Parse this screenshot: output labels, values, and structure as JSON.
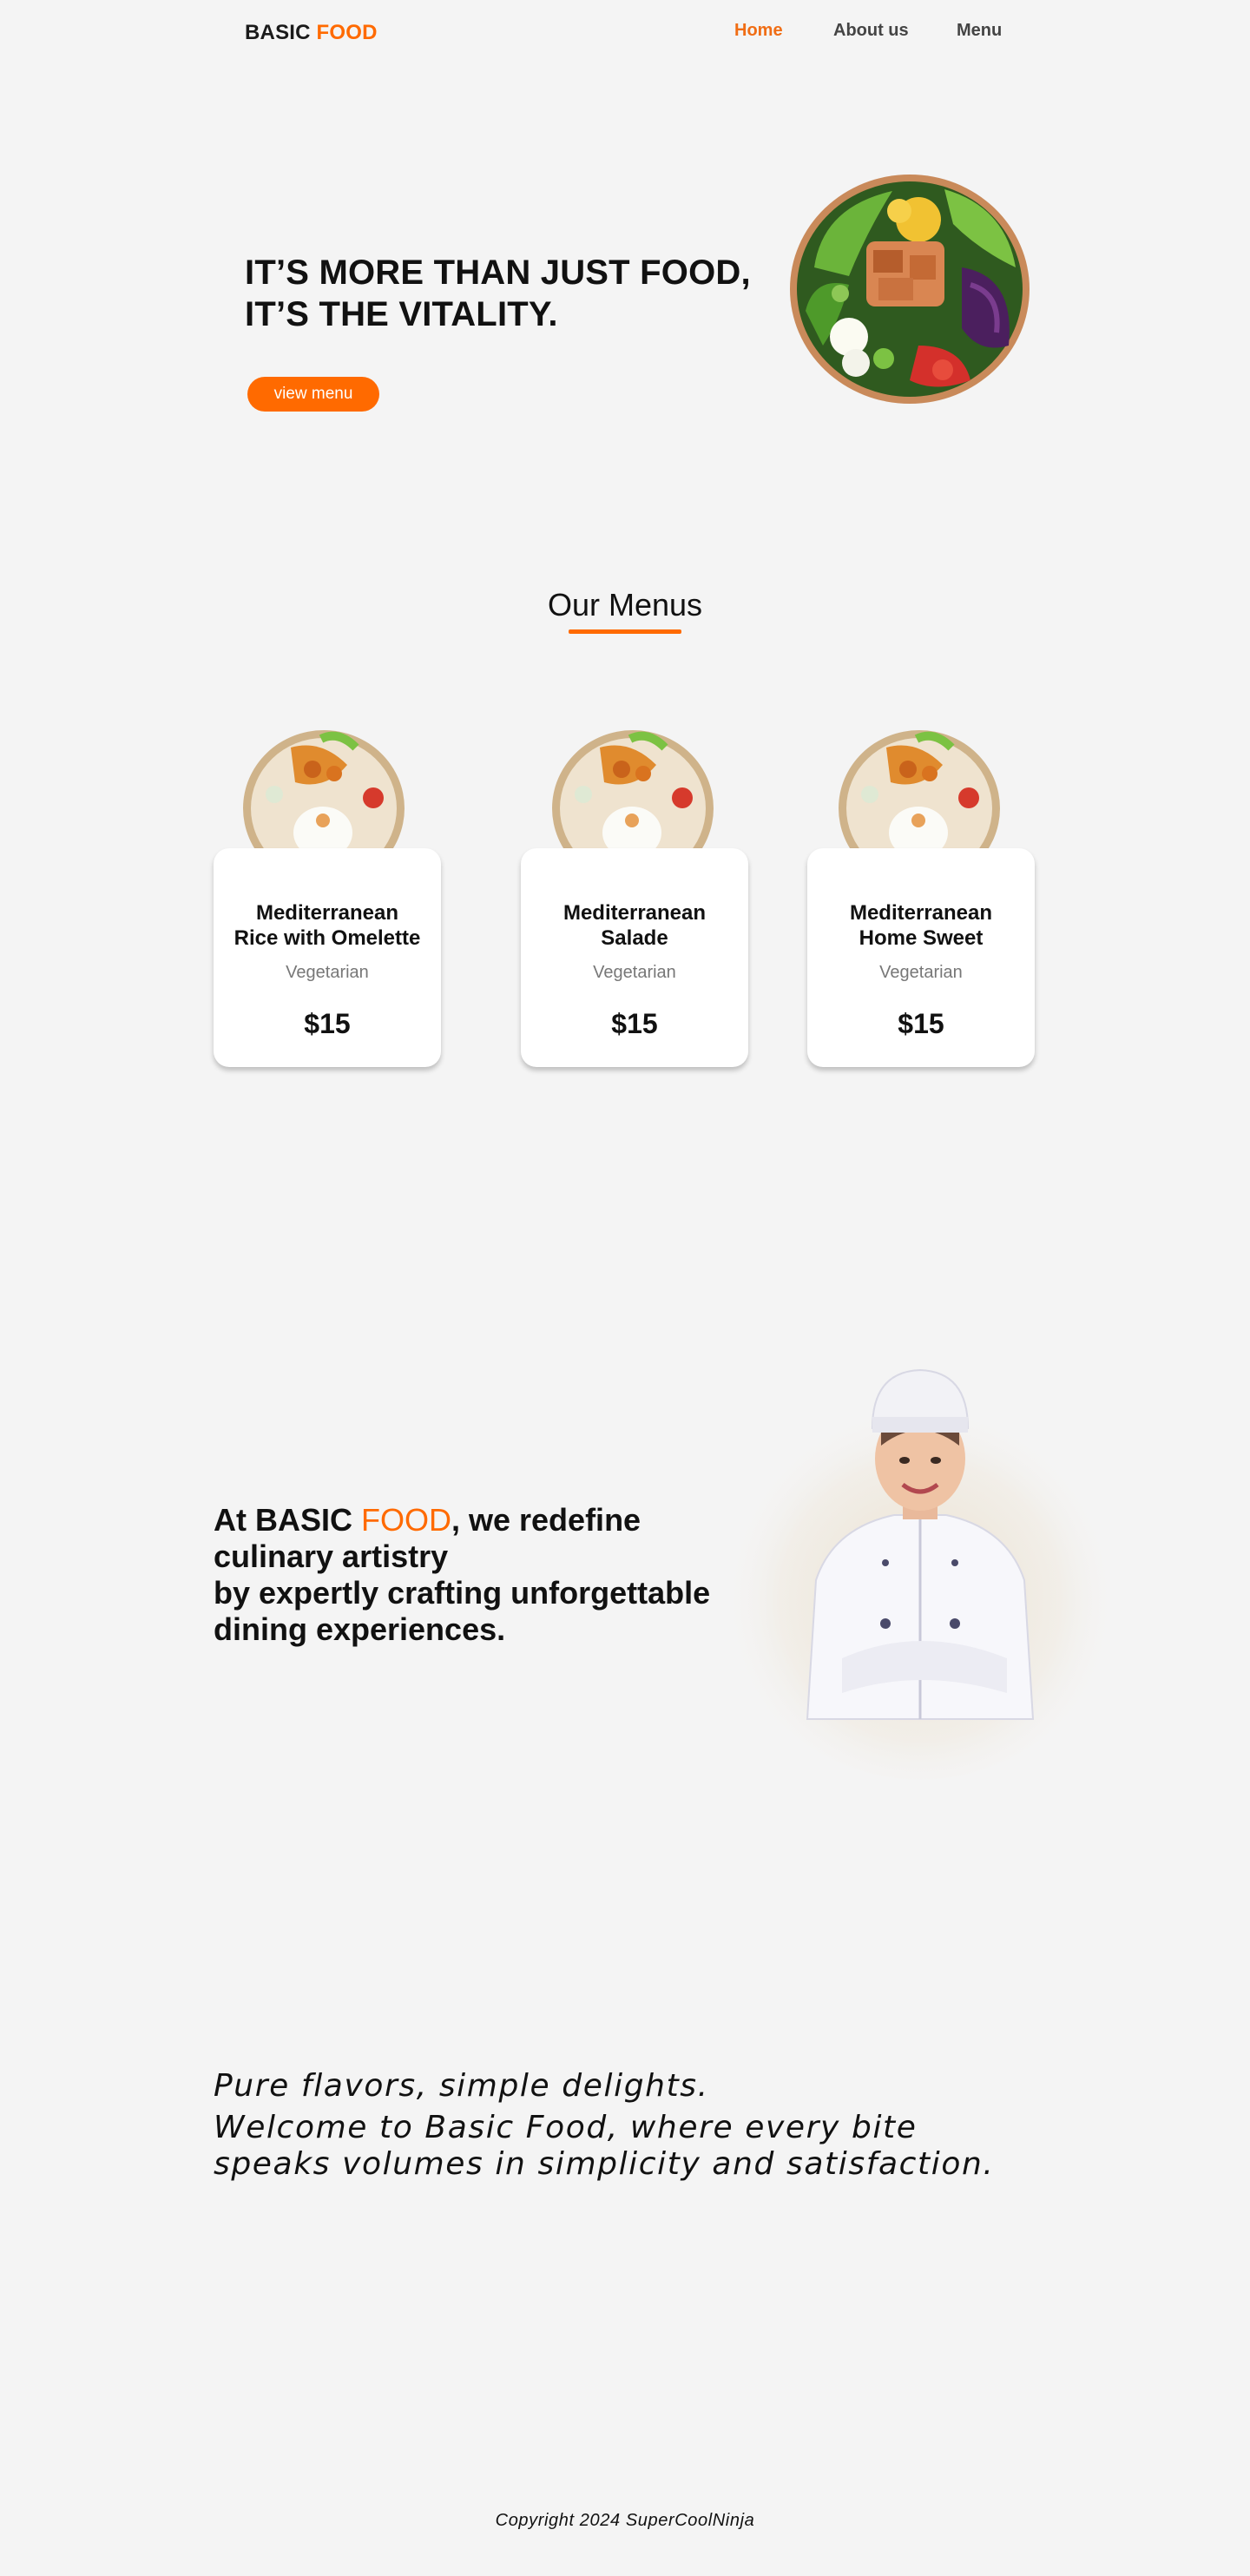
{
  "brand": {
    "prefix": "BASIC ",
    "accent": "FOOD",
    "accent_color": "#ff6a00"
  },
  "nav": {
    "items": [
      {
        "label": "Home",
        "active": true
      },
      {
        "label": "About us"
      },
      {
        "label": "Menu"
      }
    ]
  },
  "hero": {
    "line1": "IT’S MORE THAN JUST FOOD,",
    "line2": "IT’S THE VITALITY.",
    "button": "view menu"
  },
  "menus": {
    "title": "Our Menus",
    "items": [
      {
        "name_line1": "Mediterranean",
        "name_line2": "Rice with Omelette",
        "tag": "Vegetarian",
        "price": "$15"
      },
      {
        "name_line1": "Mediterranean",
        "name_line2": "Salade",
        "tag": "Vegetarian",
        "price": "$15"
      },
      {
        "name_line1": "Mediterranean",
        "name_line2": "Home Sweet",
        "tag": "Vegetarian",
        "price": "$15"
      }
    ]
  },
  "about": {
    "part1": "At BASIC ",
    "accent": "FOOD",
    "part2": ", we redefine culinary artistry",
    "part3": "by expertly crafting unforgettable dining experiences."
  },
  "quote": {
    "line1": "Pure flavors, simple delights.",
    "line2": "Welcome to Basic Food, where every bite speaks volumes in simplicity and satisfaction."
  },
  "footer": {
    "text": "Copyright 2024 SuperCoolNinja"
  }
}
